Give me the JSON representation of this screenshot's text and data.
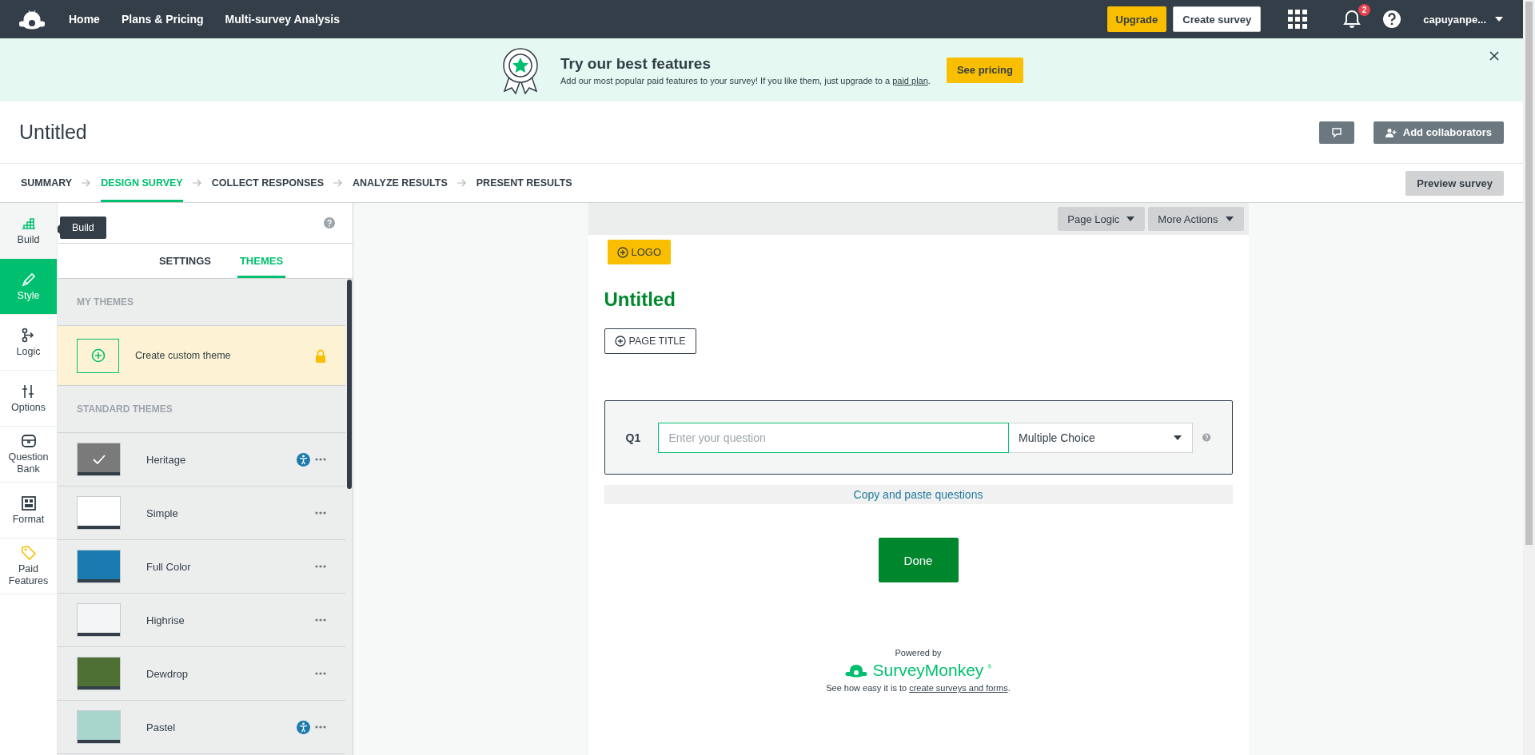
{
  "header": {
    "nav": [
      "Home",
      "Plans & Pricing",
      "Multi-survey Analysis"
    ],
    "upgrade": "Upgrade",
    "create": "Create survey",
    "notifications": "2",
    "user": "capuyanpe..."
  },
  "banner": {
    "title": "Try our best features",
    "text": "Add our most popular paid features to your survey! If you like them, just upgrade to a ",
    "link": "paid plan",
    "text_end": ".",
    "cta": "See pricing"
  },
  "survey_title": "Untitled",
  "add_collaborators": "Add collaborators",
  "steps": [
    {
      "label": "SUMMARY",
      "selected": false
    },
    {
      "label": "DESIGN SURVEY",
      "selected": true
    },
    {
      "label": "COLLECT RESPONSES",
      "selected": false
    },
    {
      "label": "ANALYZE RESULTS",
      "selected": false
    },
    {
      "label": "PRESENT RESULTS",
      "selected": false
    }
  ],
  "preview": "Preview survey",
  "rail": [
    {
      "label": "Build",
      "selected": false
    },
    {
      "label": "Style",
      "selected": true
    },
    {
      "label": "Logic",
      "selected": false
    },
    {
      "label": "Options",
      "selected": false
    },
    {
      "label": "Question Bank",
      "selected": false
    },
    {
      "label": "Format",
      "selected": false
    },
    {
      "label": "Paid Features",
      "selected": false
    }
  ],
  "tooltip": "Build",
  "panel": {
    "tabs": [
      {
        "label": "SETTINGS",
        "selected": false
      },
      {
        "label": "THEMES",
        "selected": true
      }
    ],
    "my_heading": "MY THEMES",
    "custom_theme": "Create custom theme",
    "standard_heading": "STANDARD THEMES",
    "themes": [
      {
        "name": "Heritage",
        "selected": true,
        "accessible": true,
        "color": "#7a7a7a"
      },
      {
        "name": "Simple",
        "selected": false,
        "accessible": false,
        "color": "#ffffff"
      },
      {
        "name": "Full Color",
        "selected": false,
        "accessible": false,
        "color": "#1a7bb0"
      },
      {
        "name": "Highrise",
        "selected": false,
        "accessible": false,
        "color": "#f4f5f7"
      },
      {
        "name": "Dewdrop",
        "selected": false,
        "accessible": false,
        "color": "#4f7034"
      },
      {
        "name": "Pastel",
        "selected": false,
        "accessible": true,
        "color": "#a8d5cc"
      }
    ]
  },
  "canvas": {
    "toolbar": [
      "Page Logic",
      "More Actions"
    ],
    "logo": "LOGO",
    "title": "Untitled",
    "page_title": "PAGE TITLE",
    "question": {
      "number": "Q1",
      "placeholder": "Enter your question",
      "type": "Multiple Choice"
    },
    "copy_paste": "Copy and paste questions",
    "done": "Done",
    "footer": {
      "powered_by": "Powered by",
      "brand": "SurveyMonkey",
      "brand_mark": "®",
      "text": "See how easy it is to ",
      "link": "create surveys and forms",
      "text_end": "."
    }
  }
}
